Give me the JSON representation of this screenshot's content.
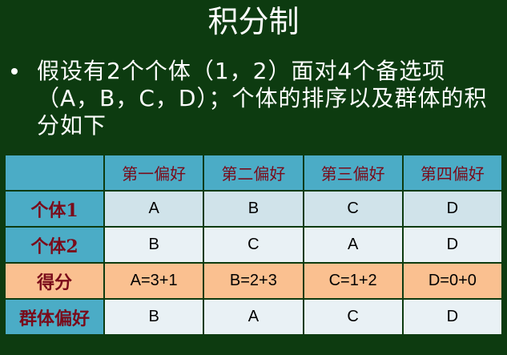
{
  "slide": {
    "title": "积分制",
    "bullet": "假设有2个个体（1，2）面对4个备选项（A，B，C，D）；个体的排序以及群体的积分如下"
  },
  "table": {
    "corner": "",
    "columns": [
      "第一偏好",
      "第二偏好",
      "第三偏好",
      "第四偏好"
    ],
    "rows": [
      {
        "label": "个体1",
        "cells": [
          "A",
          "B",
          "C",
          "D"
        ]
      },
      {
        "label": "个体2",
        "cells": [
          "B",
          "C",
          "A",
          "D"
        ]
      },
      {
        "label": "得分",
        "cells": [
          "A=3+1",
          "B=2+3",
          "C=1+2",
          "D=0+0"
        ]
      },
      {
        "label": "群体偏好",
        "cells": [
          "B",
          "A",
          "C",
          "D"
        ]
      }
    ]
  },
  "colors": {
    "background": "#0d3b10",
    "header_fill": "#4bacc6",
    "header_text": "#7a0b1a",
    "score_row_fill": "#fac090",
    "row_fill_dark": "#d0e3ea",
    "row_fill_light": "#e9f1f5"
  }
}
